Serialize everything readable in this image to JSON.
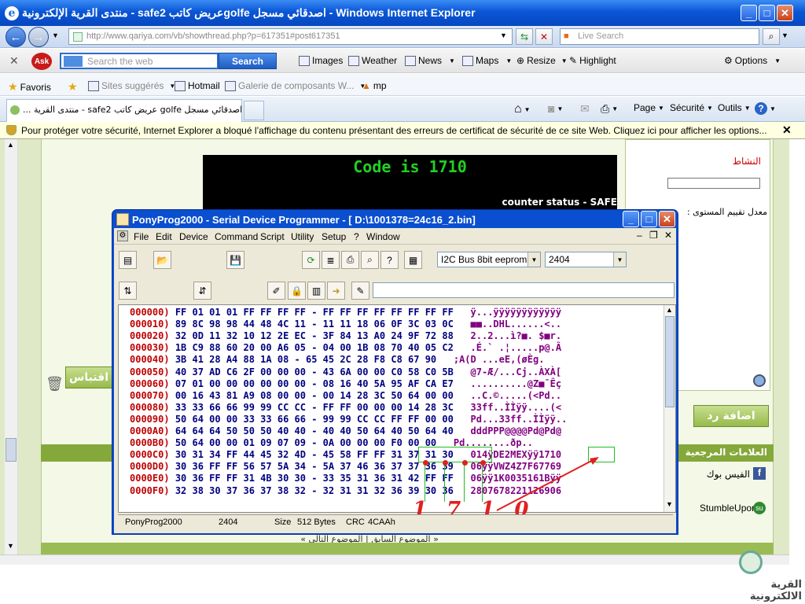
{
  "ie": {
    "title": "منتدى القرية الإلكترونية - safe2 عريض كاتبgolfe اصدقائي مسجل - Windows Internet Explorer",
    "url": "http://www.qariya.com/vb/showthread.php?p=617351#post617351",
    "live_search_placeholder": "Live Search",
    "ask_placeholder": "Search the web",
    "ask_search_label": "Search",
    "toolbar": {
      "images": "Images",
      "weather": "Weather",
      "news": "News",
      "maps": "Maps",
      "resize": "Resize",
      "highlight": "Highlight",
      "options": "Options"
    },
    "favorites": {
      "favoris": "Favoris",
      "sites": "Sites suggérés",
      "hotmail": "Hotmail",
      "galerie": "Galerie de composants W...",
      "mp": "mp"
    },
    "tab_title": "... منتدى القرية - safe2 عريض كاتب golfe اصدقائي مسجل",
    "commands": {
      "page": "Page",
      "securite": "Sécurité",
      "outils": "Outils"
    },
    "infobar": "Pour protéger votre sécurité, Internet Explorer a bloqué l’affichage du contenu présentant des erreurs de certificat de sécurité de ce site Web. Cliquez ici pour afficher les options..."
  },
  "forum": {
    "code_text": "Code is 1710",
    "counter_text": "counter status - SAFE",
    "activity_label": "النشاط",
    "level_label": "معدل تقييم المستوى :",
    "reply_button": "اضافة رد",
    "quote_button": "اقتباس",
    "bookmarks_header": "العلامات المرجعية",
    "facebook": "الفيس بوك",
    "stumbleupon": "StumbleUpon",
    "page_nav": "« الموضوع السابق | الموضوع التالي »",
    "bottom_logo": "القرية الالكترونية"
  },
  "pony": {
    "title": "PonyProg2000 - Serial Device Programmer - [ D:\\1001378=24c16_2.bin]",
    "menu": [
      "File",
      "Edit",
      "Device",
      "Command",
      "Script",
      "Utility",
      "Setup",
      "?",
      "Window"
    ],
    "device_family": "I2C Bus 8bit eeprom",
    "device_type": "2404",
    "hex_rows": [
      {
        "addr": "000000)",
        "bytes": "FF 01 01 01 FF FF FF FF - FF FF FF FF FF FF FF FF",
        "ascii": "ÿ...ÿÿÿÿÿÿÿÿÿÿÿÿ"
      },
      {
        "addr": "000010)",
        "bytes": "89 8C 98 98 44 48 4C 11 - 11 11 18 06 0F 3C 03 0C",
        "ascii": "■■..DHL......<.."
      },
      {
        "addr": "000020)",
        "bytes": "32 0D 11 32 10 12 2E EC - 3F 84 13 A0 24 9F 72 88",
        "ascii": "2..2...ì?■. $■r."
      },
      {
        "addr": "000030)",
        "bytes": "1B C9 88 60 20 00 A6 05 - 04 00 1B 08 70 40 05 C2",
        "ascii": ".É.` .¦.....p@.Â"
      },
      {
        "addr": "000040)",
        "bytes": "3B 41 28 A4 88 1A 08 - 65 45 2C 28 F8 C8 67 90",
        "ascii": ";A(D ...eE,(øÈg."
      },
      {
        "addr": "000050)",
        "bytes": "40 37 AD C6 2F 00 00 00 - 43 6A 00 00 C0 58 C0 5B",
        "ascii": "@7-Æ/...Cj..ÀXÀ["
      },
      {
        "addr": "000060)",
        "bytes": "07 01 00 00 00 00 00 00 - 08 16 40 5A 95 AF CA E7",
        "ascii": "..........@Z■¯Êç"
      },
      {
        "addr": "000070)",
        "bytes": "00 16 43 81 A9 08 00 00 - 00 14 28 3C 50 64 00 00",
        "ascii": "..C.©.....(<Pd.."
      },
      {
        "addr": "000080)",
        "bytes": "33 33 66 66 99 99 CC CC - FF FF 00 00 00 14 28 3C",
        "ascii": "33ff..ÌÌÿÿ....(<"
      },
      {
        "addr": "000090)",
        "bytes": "50 64 00 00 33 33 66 66 - 99 99 CC CC FF FF 00 00",
        "ascii": "Pd...33ff..ÌÌÿÿ.."
      },
      {
        "addr": "0000A0)",
        "bytes": "64 64 64 50 50 50 40 40 - 40 40 50 64 40 50 64 40",
        "ascii": "dddPPP@@@@Pd@Pd@"
      },
      {
        "addr": "0000B0)",
        "bytes": "50 64 00 00 01 09 07 09 - 0A 00 00 00 F0 00 00",
        "ascii": "Pd........ðp.."
      },
      {
        "addr": "0000C0)",
        "bytes": "30 31 34 FF 44 45 32 4D - 45 58 FF FF 31 37 31 30",
        "ascii": "014ÿDE2MEXÿÿ1710"
      },
      {
        "addr": "0000D0)",
        "bytes": "30 36 FF FF 56 57 5A 34 - 5A 37 46 36 37 37 36 39",
        "ascii": "06ÿÿVWZ4Z7F67769"
      },
      {
        "addr": "0000E0)",
        "bytes": "30 36 FF FF 31 4B 30 30 - 33 35 31 36 31 42 FF FF",
        "ascii": "06ÿÿ1K0035161Bÿÿ"
      },
      {
        "addr": "0000F0)",
        "bytes": "32 38 30 37 36 37 38 32 - 32 31 31 32 36 39 30 36",
        "ascii": "2807678221126906"
      }
    ],
    "status": {
      "app": "PonyProg2000",
      "device": "2404",
      "size_label": "Size",
      "size_value": "512 Bytes",
      "crc_label": "CRC",
      "crc_value": "4CAAh"
    },
    "annotation": "1 7 1 0"
  }
}
